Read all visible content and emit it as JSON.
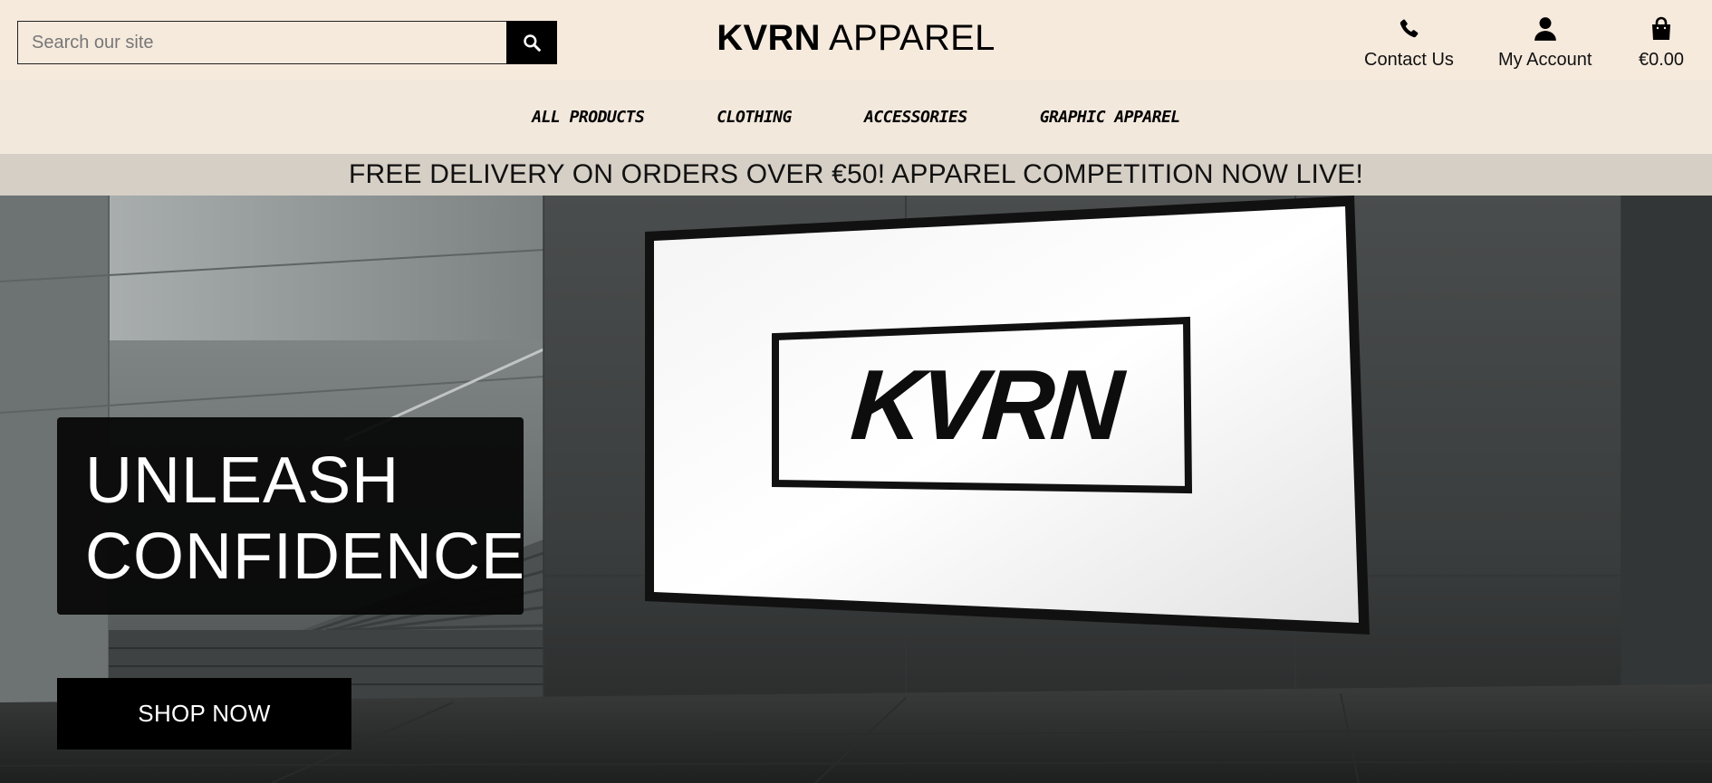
{
  "header": {
    "search": {
      "placeholder": "Search our site"
    },
    "brand": {
      "bold": "KVRN",
      "light": "APPAREL"
    },
    "contact_label": "Contact Us",
    "account_label": "My Account",
    "bag_total": "€0.00"
  },
  "nav": {
    "items": [
      {
        "label": "ALL PRODUCTS"
      },
      {
        "label": "CLOTHING"
      },
      {
        "label": "ACCESSORIES"
      },
      {
        "label": "GRAPHIC APPAREL"
      }
    ]
  },
  "banner": {
    "text": "FREE DELIVERY ON ORDERS OVER €50! APPAREL COMPETITION NOW LIVE!"
  },
  "hero": {
    "headline_line1": "UNLEASH",
    "headline_line2": "CONFIDENCE",
    "cta_label": "SHOP NOW",
    "billboard_logo": "KVRN"
  },
  "colors": {
    "header_bg": "#f6eadd",
    "nav_bg": "#f2e8dc",
    "banner_bg": "#d6cfc5",
    "button_bg": "#000000"
  },
  "icons": {
    "search": "search-icon",
    "contact": "phone-icon",
    "account": "user-icon",
    "bag": "shopping-bag-icon"
  }
}
